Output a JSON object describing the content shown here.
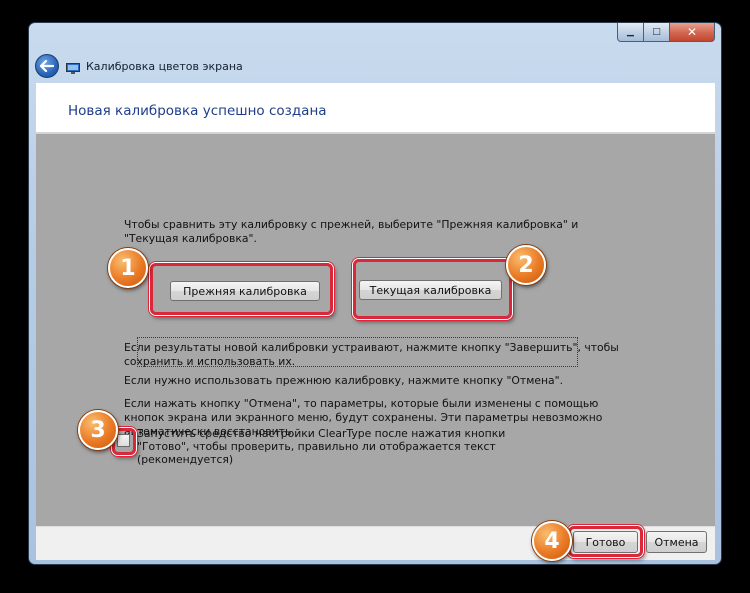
{
  "window": {
    "title": "Калибровка цветов экрана",
    "caption_buttons": {
      "minimize": "▁",
      "maximize": "□",
      "close": "✕"
    }
  },
  "header": {
    "heading": "Новая калибровка успешно создана"
  },
  "main": {
    "intro": "Чтобы сравнить эту калибровку с прежней, выберите \"Прежняя калибровка\" и \"Текущая калибровка\".",
    "previous_button": "Прежняя калибровка",
    "current_button": "Текущая калибровка",
    "para_finish": "Если результаты новой калибровки устраивают, нажмите кнопку \"Завершить\", чтобы сохранить и использовать их.",
    "para_cancel": "Если нужно использовать прежнюю калибровку, нажмите кнопку \"Отмена\".",
    "para_note": "Если нажать кнопку \"Отмена\", то параметры, которые были изменены с помощью кнопок экрана или экранного меню, будут сохранены. Эти параметры невозможно автоматически восстановить.",
    "cleartype_checkbox": {
      "label": "Запустить средство настройки ClearType после нажатия кнопки \"Готово\", чтобы проверить, правильно ли отображается текст (рекомендуется)",
      "checked": false
    }
  },
  "footer": {
    "done_button": "Готово",
    "cancel_button": "Отмена"
  },
  "annotations": {
    "badge1": "1",
    "badge2": "2",
    "badge3": "3",
    "badge4": "4"
  },
  "colors": {
    "highlight": "#d8283a",
    "badge": "#ea7a25",
    "heading": "#1f3d8a",
    "content_bg": "#a7a7a7"
  }
}
